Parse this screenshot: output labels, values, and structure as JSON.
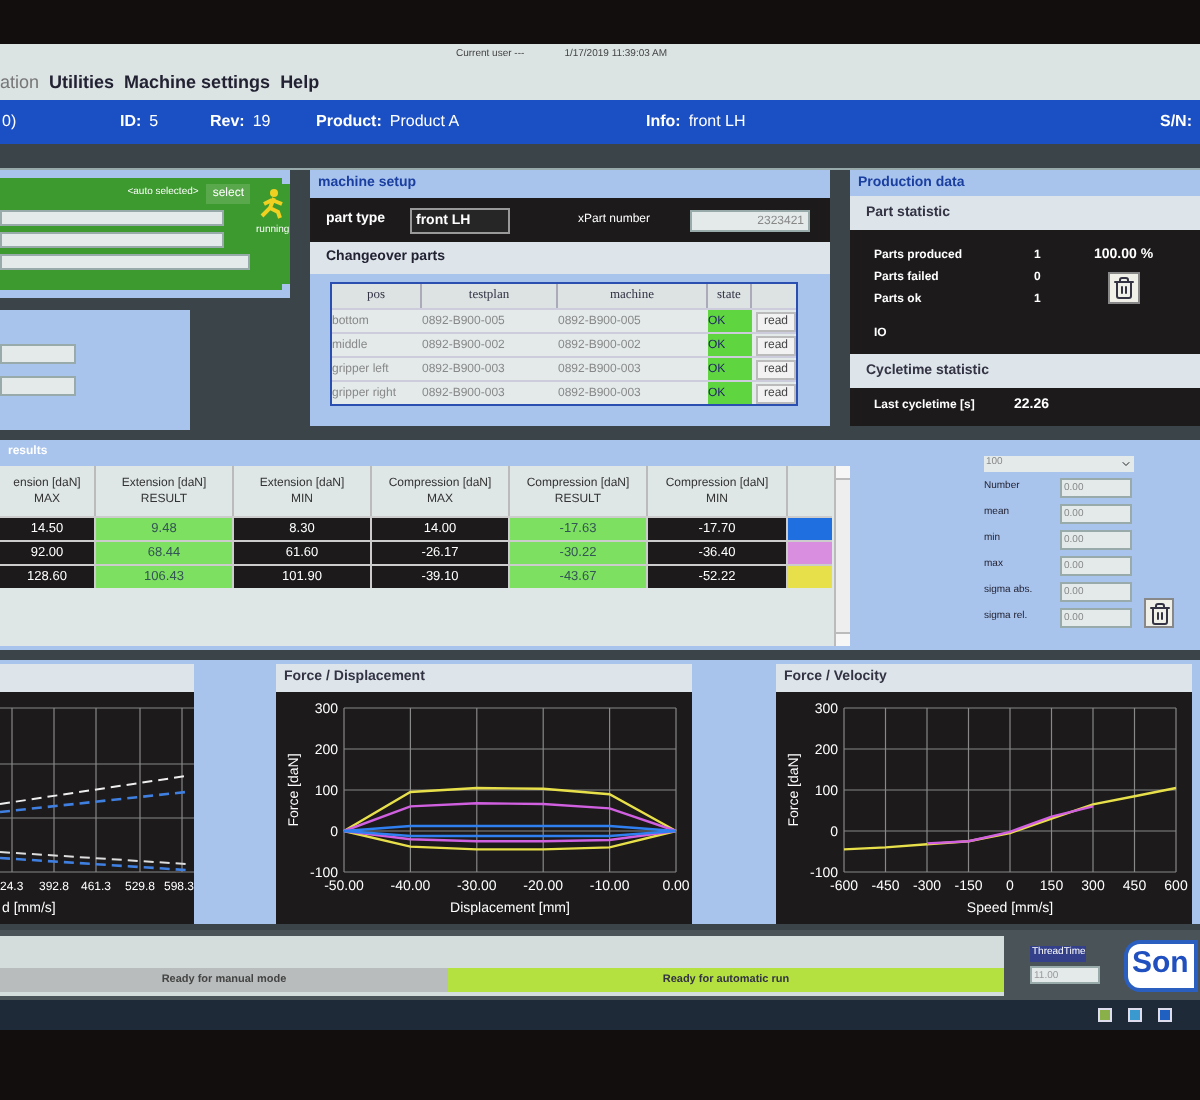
{
  "header": {
    "current_user": "Current user ---",
    "datetime": "1/17/2019 11:39:03 AM"
  },
  "menu": [
    "ation",
    "Utilities",
    "Machine settings",
    "Help"
  ],
  "info_bar": {
    "cut_text": "0)",
    "items": [
      {
        "label": "ID:",
        "value": "5"
      },
      {
        "label": "Rev:",
        "value": "19"
      },
      {
        "label": "Product:",
        "value": "Product A"
      },
      {
        "label": "Info:",
        "value": "front LH"
      },
      {
        "label": "S/N:"
      }
    ]
  },
  "selection_panel": {
    "selection": "<auto selected>",
    "select_button": "select",
    "status": "running"
  },
  "machine_setup": {
    "title": "machine setup",
    "part_type_label": "part type",
    "part_type": "front LH",
    "part_number_label": "xPart number",
    "part_number": "2323421",
    "changeover_title": "Changeover parts",
    "columns": [
      "pos",
      "testplan",
      "machine",
      "state"
    ],
    "rows": [
      {
        "pos": "bottom",
        "testplan": "0892-B900-005",
        "machine": "0892-B900-005",
        "state": "OK",
        "ok": true,
        "button": "read"
      },
      {
        "pos": "middle",
        "testplan": "0892-B900-002",
        "machine": "0892-B900-002",
        "state": "OK",
        "ok": true,
        "button": "read"
      },
      {
        "pos": "gripper left",
        "testplan": "0892-B900-003",
        "machine": "0892-B900-003",
        "state": "OK",
        "ok": true,
        "button": "read"
      },
      {
        "pos": "gripper right",
        "testplan": "0892-B900-003",
        "machine": "0892-B900-003",
        "state": "OK",
        "ok": true,
        "button": "read"
      }
    ]
  },
  "production_data": {
    "title": "Production data",
    "part_statistic_title": "Part statistic",
    "stats": [
      {
        "label": "Parts produced",
        "value": "1",
        "extra": "100.00 %"
      },
      {
        "label": "Parts failed",
        "value": "0"
      },
      {
        "label": "Parts ok",
        "value": "1"
      }
    ],
    "io": "IO",
    "cycletime_title": "Cycletime statistic",
    "last_cycletime_label": "Last cycletime [s]",
    "last_cycletime": "22.26"
  },
  "results": {
    "title": "results",
    "columns": [
      {
        "label": "ension [daN]",
        "sub": "MAX",
        "kind": "limit"
      },
      {
        "label": "Extension [daN]",
        "sub": "RESULT",
        "kind": "result"
      },
      {
        "label": "Extension [daN]",
        "sub": "MIN",
        "kind": "limit"
      },
      {
        "label": "Compression [daN]",
        "sub": "MAX",
        "kind": "limit"
      },
      {
        "label": "Compression [daN]",
        "sub": "RESULT",
        "kind": "result"
      },
      {
        "label": "Compression [daN]",
        "sub": "MIN",
        "kind": "limit"
      }
    ],
    "rows": [
      {
        "cells": [
          "14.50",
          "9.48",
          "8.30",
          "14.00",
          "-17.63",
          "-17.70"
        ],
        "color": "#1f6fe0"
      },
      {
        "cells": [
          "92.00",
          "68.44",
          "61.60",
          "-26.17",
          "-30.22",
          "-36.40"
        ],
        "color": "#d98ee0"
      },
      {
        "cells": [
          "128.60",
          "106.43",
          "101.90",
          "-39.10",
          "-43.67",
          "-52.22"
        ],
        "color": "#e8e04a"
      }
    ],
    "statistics": {
      "dropdown": "100",
      "fields": [
        {
          "label": "Number",
          "value": "0.00"
        },
        {
          "label": "mean",
          "value": "0.00"
        },
        {
          "label": "min",
          "value": "0.00"
        },
        {
          "label": "max",
          "value": "0.00"
        },
        {
          "label": "sigma abs.",
          "value": "0.00"
        },
        {
          "label": "sigma rel.",
          "value": "0.00"
        }
      ]
    }
  },
  "charts": [
    {
      "kind": "picture",
      "xtick_labels": [
        "24.3",
        "392.8",
        "461.3",
        "529.8",
        "598.3"
      ],
      "xlabel": "d [mm/s]"
    },
    {
      "kind": "chart",
      "chart_data": {
        "type": "line",
        "grid": true,
        "title": "Force / Displacement",
        "xlabel": "Displacement [mm]",
        "ylabel": "Force [daN]",
        "x": [
          -50,
          -40,
          -30,
          -20,
          -10,
          0
        ],
        "xlim": [
          -50,
          0
        ],
        "ylim": [
          -100,
          300
        ],
        "xticks": [
          {
            "value": -50,
            "label": "-50.00"
          },
          {
            "value": -40,
            "label": "-40.00"
          },
          {
            "value": -30,
            "label": "-30.00"
          },
          {
            "value": -20,
            "label": "-20.00"
          },
          {
            "value": -10,
            "label": "-10.00"
          },
          {
            "value": 0,
            "label": "0.00"
          }
        ],
        "yticks": [
          -100,
          0,
          100,
          200,
          300
        ],
        "series": [
          {
            "color": "#e8e04a",
            "values": [
              0,
              95,
              105,
              103,
              90,
              0
            ]
          },
          {
            "color": "#e8e04a",
            "values": [
              0,
              -38,
              -45,
              -45,
              -40,
              0
            ]
          },
          {
            "color": "#d060e0",
            "values": [
              0,
              60,
              68,
              66,
              55,
              0
            ]
          },
          {
            "color": "#d060e0",
            "values": [
              0,
              -20,
              -25,
              -25,
              -22,
              0
            ]
          },
          {
            "color": "#2f7ff0",
            "values": [
              0,
              12,
              12,
              12,
              12,
              0
            ]
          },
          {
            "color": "#2f7ff0",
            "values": [
              0,
              -12,
              -12,
              -12,
              -12,
              0
            ]
          }
        ]
      }
    },
    {
      "kind": "chart",
      "chart_data": {
        "type": "line",
        "grid": true,
        "title": "Force / Velocity",
        "xlabel": "Speed [mm/s]",
        "ylabel": "Force [daN]",
        "x": [
          -600,
          -450,
          -300,
          -150,
          0,
          150,
          300,
          450,
          600
        ],
        "xlim": [
          -600,
          600
        ],
        "ylim": [
          -100,
          300
        ],
        "xticks": [
          -600,
          -450,
          -300,
          -150,
          0,
          150,
          300,
          450,
          600
        ],
        "yticks": [
          -100,
          0,
          100,
          200,
          300
        ],
        "series": [
          {
            "color": "#e8e04a",
            "values": [
              -45,
              -40,
              -32,
              -25,
              -5,
              30,
              65,
              85,
              105
            ]
          },
          {
            "color": "#d060e0",
            "values": [
              null,
              null,
              -30,
              -25,
              -2,
              35,
              60,
              null,
              null
            ]
          }
        ]
      }
    }
  ],
  "status_bar": {
    "modes": [
      {
        "label": "Ready for manual mode",
        "active": false
      },
      {
        "label": "Ready for automatic run",
        "active": true
      }
    ],
    "thread_time_label": "ThreadTime",
    "thread_time": "11.00",
    "logo": "Son"
  }
}
